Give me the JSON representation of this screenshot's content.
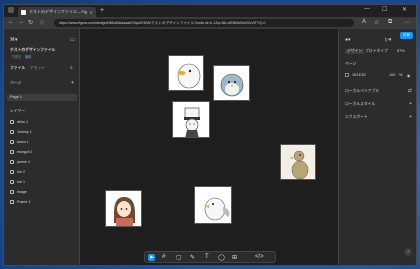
{
  "browser": {
    "tab_title": "テストのデザインファイル – Figma",
    "url": "https://www.figma.com/design/hBDaN6aaaabS3yd4F8rW/テストのデザインファイル?node-id=0-1&p=f&t=dEiBhM4dX0oVtTYQ-0",
    "new_tab": "+",
    "minimize": "—",
    "maximize": "☐",
    "close": "✕"
  },
  "file": {
    "name": "テストのデザインファイル",
    "tag_free": "下書き",
    "tag_plan": "無料",
    "tabs": [
      "ファイル",
      "アセット"
    ]
  },
  "pages": {
    "header": "ページ",
    "items": [
      "Page 1"
    ]
  },
  "layers": {
    "header": "レイヤー",
    "items": [
      "ahiru 1",
      "Johnny 1",
      "kamo 1",
      "mongoli 1",
      "penne 1",
      "tori 2",
      "tori 1",
      "image",
      "Frame 1"
    ]
  },
  "right": {
    "tabs": [
      "デザイン",
      "プロトタイプ"
    ],
    "zoom": "57%",
    "page_section": "ページ",
    "bg_hex": "1E1E1E",
    "bg_opacity": "100",
    "bg_unit": "%",
    "local_vars": "ローカルバリアブル",
    "local_styles": "ローカルスタイル",
    "export": "エクスポート",
    "share": "共有"
  },
  "help": "?"
}
